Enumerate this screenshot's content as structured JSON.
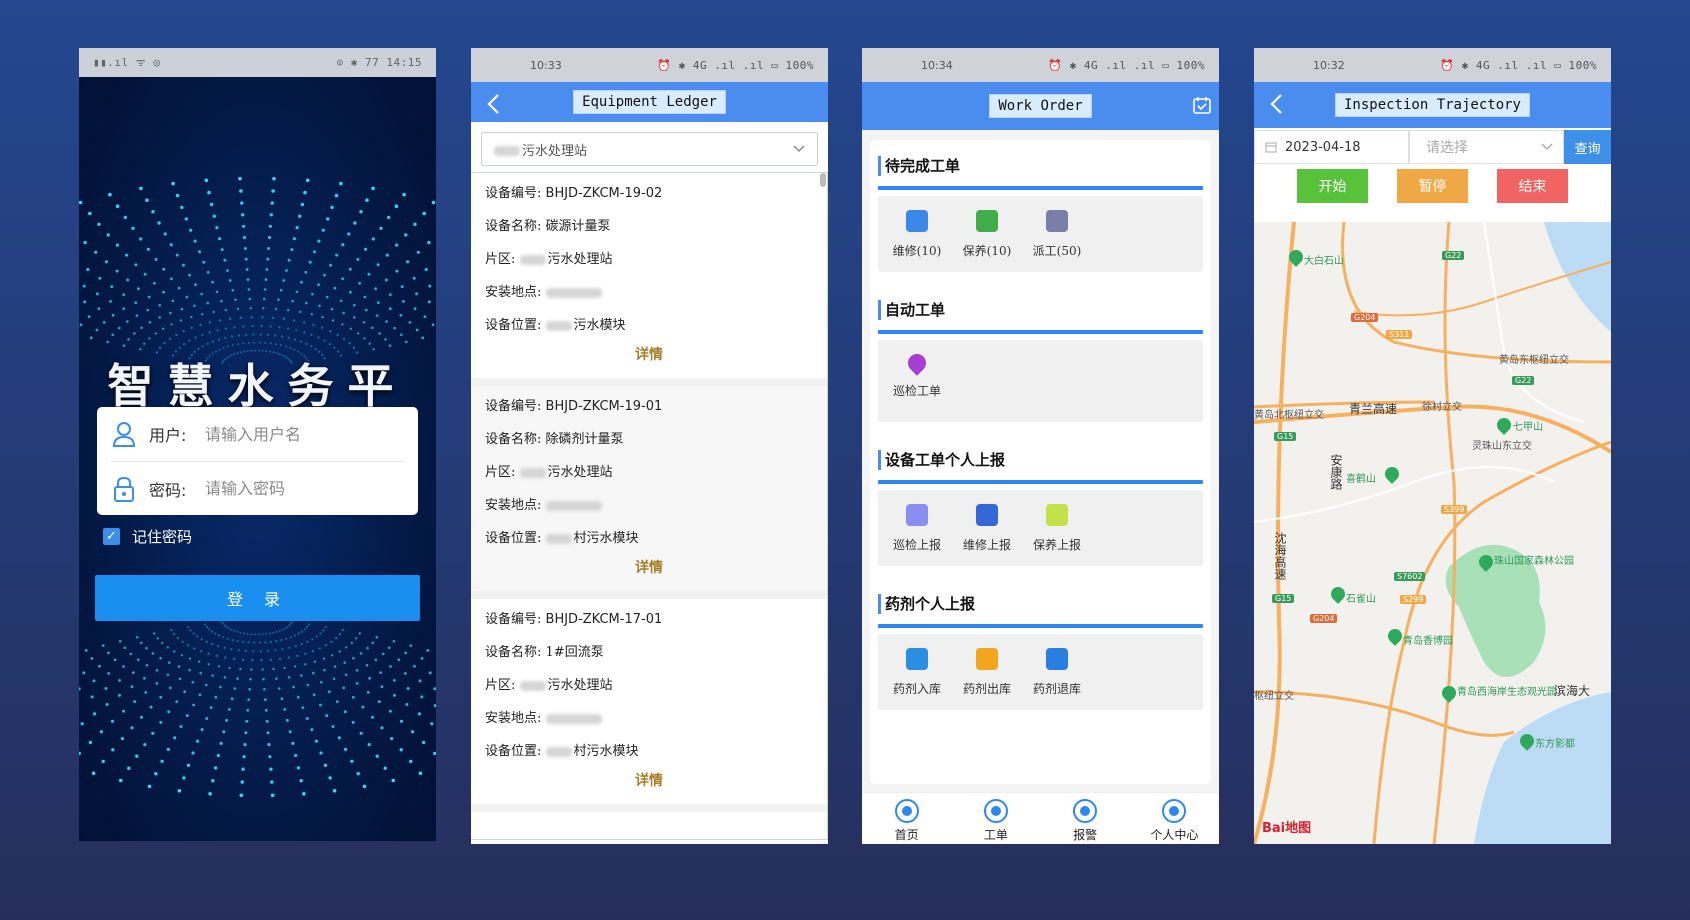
{
  "login": {
    "status_icons": "▮▮.ıl ᯤ ◎",
    "status_right": "⊙ ✱ 77 14:15",
    "title": "智慧水务平台",
    "user_label": "用户:",
    "user_placeholder": "请输入用户名",
    "pwd_label": "密码:",
    "pwd_placeholder": "请输入密码",
    "remember_label": "记住密码",
    "remember_checked": true,
    "login_button": "登 录"
  },
  "ledger": {
    "status_time": "10:33",
    "status_right": "⏰ ✱ 4G .ıl .ıl ▭ 100%",
    "title": "Equipment Ledger",
    "area_select": "污水处理站",
    "detail_label": "详情",
    "items": [
      {
        "code_label": "设备编号:",
        "code": "BHJD-ZKCM-19-02",
        "name_label": "设备名称:",
        "name": "碳源计量泵",
        "zone_label": "片区:",
        "zone": "污水处理站",
        "install_label": "安装地点:",
        "pos_label": "设备位置:",
        "pos": "污水模块"
      },
      {
        "code_label": "设备编号:",
        "code": "BHJD-ZKCM-19-01",
        "name_label": "设备名称:",
        "name": "除磷剂计量泵",
        "zone_label": "片区:",
        "zone": "污水处理站",
        "install_label": "安装地点:",
        "pos_label": "设备位置:",
        "pos": "村污水模块"
      },
      {
        "code_label": "设备编号:",
        "code": "BHJD-ZKCM-17-01",
        "name_label": "设备名称:",
        "name": "1#回流泵",
        "zone_label": "片区:",
        "zone": "污水处理站",
        "install_label": "安装地点:",
        "pos_label": "设备位置:",
        "pos": "村污水模块"
      }
    ]
  },
  "workorder": {
    "status_time": "10:34",
    "status_right": "⏰ ✱ 4G .ıl .ıl ▭ 100%",
    "title": "Work Order",
    "sections": [
      {
        "title": "待完成工单",
        "items": [
          {
            "label": "维修(10)",
            "icon": "repair-icon",
            "color": "#3b88e6"
          },
          {
            "label": "保养(10)",
            "icon": "maintain-icon",
            "color": "#3fae4a"
          },
          {
            "label": "派工(50)",
            "icon": "dispatch-icon",
            "color": "#7a7fa8"
          }
        ]
      },
      {
        "title": "自动工单",
        "items": [
          {
            "label": "巡检工单",
            "icon": "location-icon",
            "color": "#a53fd1"
          }
        ]
      },
      {
        "title": "设备工单个人上报",
        "items": [
          {
            "label": "巡检上报",
            "icon": "inspect-report-icon",
            "color": "#8a8ef0"
          },
          {
            "label": "维修上报",
            "icon": "repair-report-icon",
            "color": "#3468d8"
          },
          {
            "label": "保养上报",
            "icon": "maintain-report-icon",
            "color": "#c4e04a"
          }
        ]
      },
      {
        "title": "药剂个人上报",
        "items": [
          {
            "label": "药剂入库",
            "icon": "stock-in-icon",
            "color": "#2a8fe0"
          },
          {
            "label": "药剂出库",
            "icon": "stock-out-icon",
            "color": "#f2a51f"
          },
          {
            "label": "药剂退库",
            "icon": "stock-return-icon",
            "color": "#2a7ee0"
          }
        ]
      }
    ],
    "tabs": [
      "首页",
      "工单",
      "报警",
      "个人中心"
    ]
  },
  "trajectory": {
    "status_time": "10:32",
    "status_right": "⏰ ✱ 4G .ıl .ıl ▭ 100%",
    "title": "Inspection Trajectory",
    "date": "2023-04-18",
    "select_placeholder": "请选择",
    "query_button": "查询",
    "start_button": "开始",
    "pause_button": "暂停",
    "end_button": "结束",
    "colors": {
      "start": "#58c23a",
      "pause": "#f0a846",
      "end": "#f06464"
    },
    "map_labels": {
      "dabaishan": "大白石山",
      "qingdao_east_hub": "黄岛东枢纽立交",
      "qingdao_north_hub": "黄岛北枢纽立交",
      "qinglan": "青兰高速",
      "village_hub": "徐村立交",
      "qijiashan": "七甲山",
      "lingzhu_east": "灵珠山东立交",
      "ankang": "安康路",
      "xihe": "喜鹤山",
      "shenhai": "沈海高速",
      "zhushan_park": "珠山国家森林公园",
      "shiqueshan": "石雀山",
      "qingdao_xiang": "青岛香博园",
      "hub_interchange": "枢纽立交",
      "west_coast": "青岛西海岸生态观光园",
      "binhai": "滨海大",
      "dongfang": "东方影都",
      "g22": "G22",
      "g204a": "G204",
      "s311": "S311",
      "g22b": "G22",
      "g15a": "G15",
      "s399": "S399",
      "s7602": "S7602",
      "s299": "S299",
      "g15b": "G15",
      "g204b": "G204"
    },
    "map_logo": "Bai地图"
  }
}
